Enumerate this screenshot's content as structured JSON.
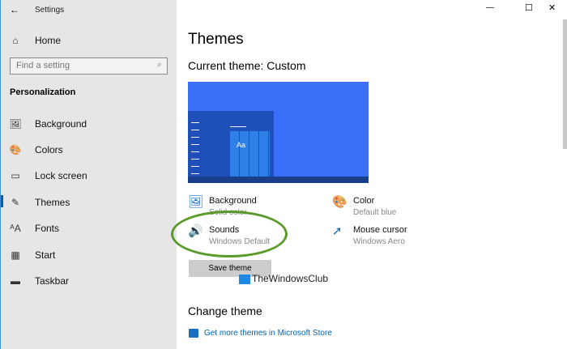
{
  "window": {
    "title": "Settings",
    "back": "←",
    "minimize": "—",
    "maximize": "☐",
    "close": "✕"
  },
  "sidebar": {
    "home": "Home",
    "search_placeholder": "Find a setting",
    "section": "Personalization",
    "items": [
      {
        "label": "Background",
        "icon": "🖼"
      },
      {
        "label": "Colors",
        "icon": "🎨"
      },
      {
        "label": "Lock screen",
        "icon": "▭"
      },
      {
        "label": "Themes",
        "icon": "✎"
      },
      {
        "label": "Fonts",
        "icon": "ᴬA"
      },
      {
        "label": "Start",
        "icon": "▦"
      },
      {
        "label": "Taskbar",
        "icon": "▬"
      }
    ]
  },
  "main": {
    "title": "Themes",
    "current": "Current theme: Custom",
    "preview_text": "Aa",
    "options": [
      {
        "title": "Background",
        "sub": "Solid color"
      },
      {
        "title": "Color",
        "sub": "Default blue"
      },
      {
        "title": "Sounds",
        "sub": "Windows Default"
      },
      {
        "title": "Mouse cursor",
        "sub": "Windows Aero"
      }
    ],
    "save": "Save theme",
    "watermark": "TheWindowsClub",
    "change": "Change theme",
    "store_link": "Get more themes in Microsoft Store"
  },
  "colors": {
    "accent": "#0063b1",
    "preview": "#3a6ff7",
    "highlight": "#5a9a2a"
  }
}
